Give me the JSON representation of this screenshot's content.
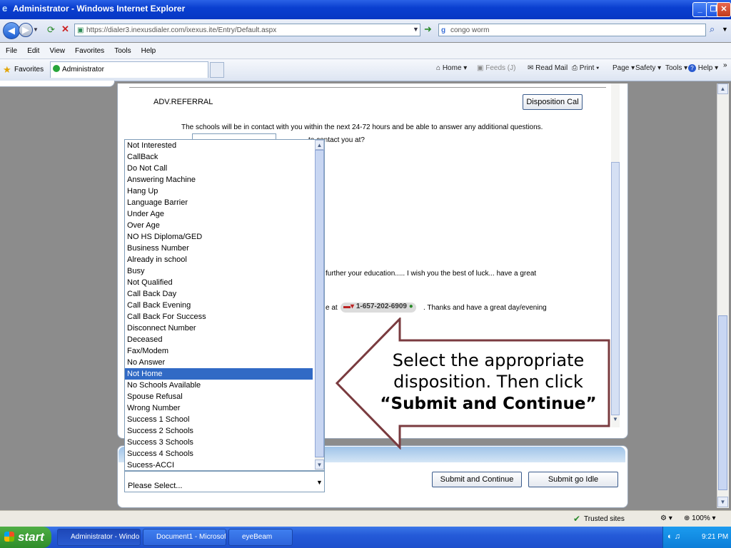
{
  "window": {
    "title": "Administrator - Windows Internet Explorer"
  },
  "addressbar": {
    "url": "https://dialer3.inexusdialer.com/ixexus.ite/Entry/Default.aspx",
    "search": "congo worm"
  },
  "menu": [
    "File",
    "Edit",
    "View",
    "Favorites",
    "Tools",
    "Help"
  ],
  "favorites": {
    "label": "Favorites",
    "tab": "Administrator"
  },
  "toolbar": {
    "home": "Home",
    "feeds": "Feeds (J)",
    "read_mail": "Read Mail",
    "print": "Print",
    "page": "Page",
    "safety": "Safety",
    "tools": "Tools",
    "help": "Help"
  },
  "page": {
    "section_title": "ADV.REFERRAL",
    "disposition_button": "Disposition Cal",
    "line1": "The schools will be in contact with you within the next 24-72 hours and be able to answer any additional questions.",
    "line2": "to contact you at?",
    "line3": "further your education..... I wish you the best of luck... have a great",
    "line4_prefix": "e at",
    "phone": "1-657-202-6909",
    "line4_suffix": ". Thanks and have a great day/evening",
    "submit_continue": "Submit and Continue",
    "submit_idle": "Submit go Idle"
  },
  "dispositions": [
    "Not Interested",
    "CallBack",
    "Do Not Call",
    "Answering Machine",
    "Hang Up",
    "Language Barrier",
    "Under Age",
    "Over Age",
    "NO HS Diploma/GED",
    "Business Number",
    "Already in school",
    "Busy",
    "Not Qualified",
    "Call Back Day",
    "Call Back Evening",
    "Call Back For Success",
    "Disconnect Number",
    "Deceased",
    "Fax/Modem",
    "No Answer",
    "Not Home",
    "No Schools Available",
    "Spouse Refusal",
    "Wrong Number",
    "Success 1 School",
    "Success 2 Schools",
    "Success 3 Schools",
    "Success 4 Schools",
    "Sucess-ACCI"
  ],
  "selected_disposition": "Not Home",
  "select_placeholder": "Please Select...",
  "callout": {
    "line1": "Select the appropriate",
    "line2": "disposition. Then click",
    "line3": "“Submit and Continue”"
  },
  "statusbar": {
    "zone": "Trusted sites",
    "zoom": "100%"
  },
  "taskbar": {
    "start": "start",
    "items": [
      "Administrator - Windo",
      "Document1 - Microsof...",
      "eyeBeam"
    ],
    "time": "9:21 PM"
  }
}
